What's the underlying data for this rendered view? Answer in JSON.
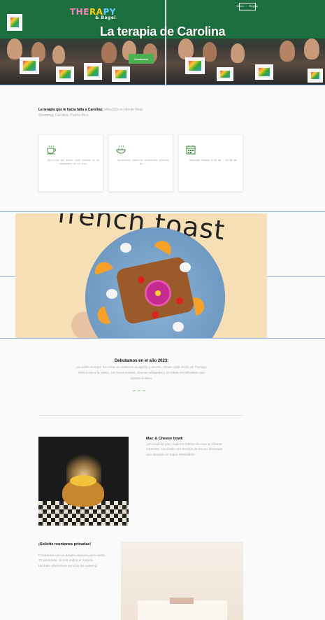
{
  "hero": {
    "logo_part1": "THE",
    "logo_part2": "RA",
    "logo_part3": "PY",
    "logo_sub": "& Bagel",
    "nav": [
      "Menu",
      "Reglas"
    ],
    "title": "La terapia de Carolina",
    "button_label": "Contactos"
  },
  "intro": {
    "bold": "La terapia que le hacía falta a Carolina:",
    "rest": " Ubicados en Monte Real Shopping, Carolina, Puerto Rico"
  },
  "cards": [
    {
      "icon": "coffee-icon",
      "text": "Disfruta del mejor café cuando no te conocemos en el día."
    },
    {
      "icon": "food-steam-icon",
      "text": "Aprovecha nuestros groserías ofertas al..."
    },
    {
      "icon": "calendar-icon",
      "text": "Domingo-Sábado 8:30 am - 10:00 pm"
    }
  ],
  "food_image": {
    "caption": "french toast"
  },
  "debut": {
    "title": "Debutamos en el año 2023:",
    "body": "La visión siempre fue crear un ambiente acogedor y sereno, donde cada rincón de Therapy Real invita a la calma, con luces suaves, aromas relajantes y un menú reconfortante que abraza el alma."
  },
  "mac": {
    "title": "Mac & Cheese bowl:",
    "body": "¡Un bowl de pan crujiente relleno de mac & cheese cremoso, coronado con trocitos de bacon ahumado que aportan un toque irresistible!"
  },
  "privadas": {
    "title": "¡Solicite reuniones privadas!",
    "body": "Contamos con un amplio espacio para hasta 72 personas. Si nos indica el horario, también ofrecemos servicio de catering."
  },
  "colors": {
    "accent": "#4caf50",
    "guide": "#8bbcf0"
  }
}
